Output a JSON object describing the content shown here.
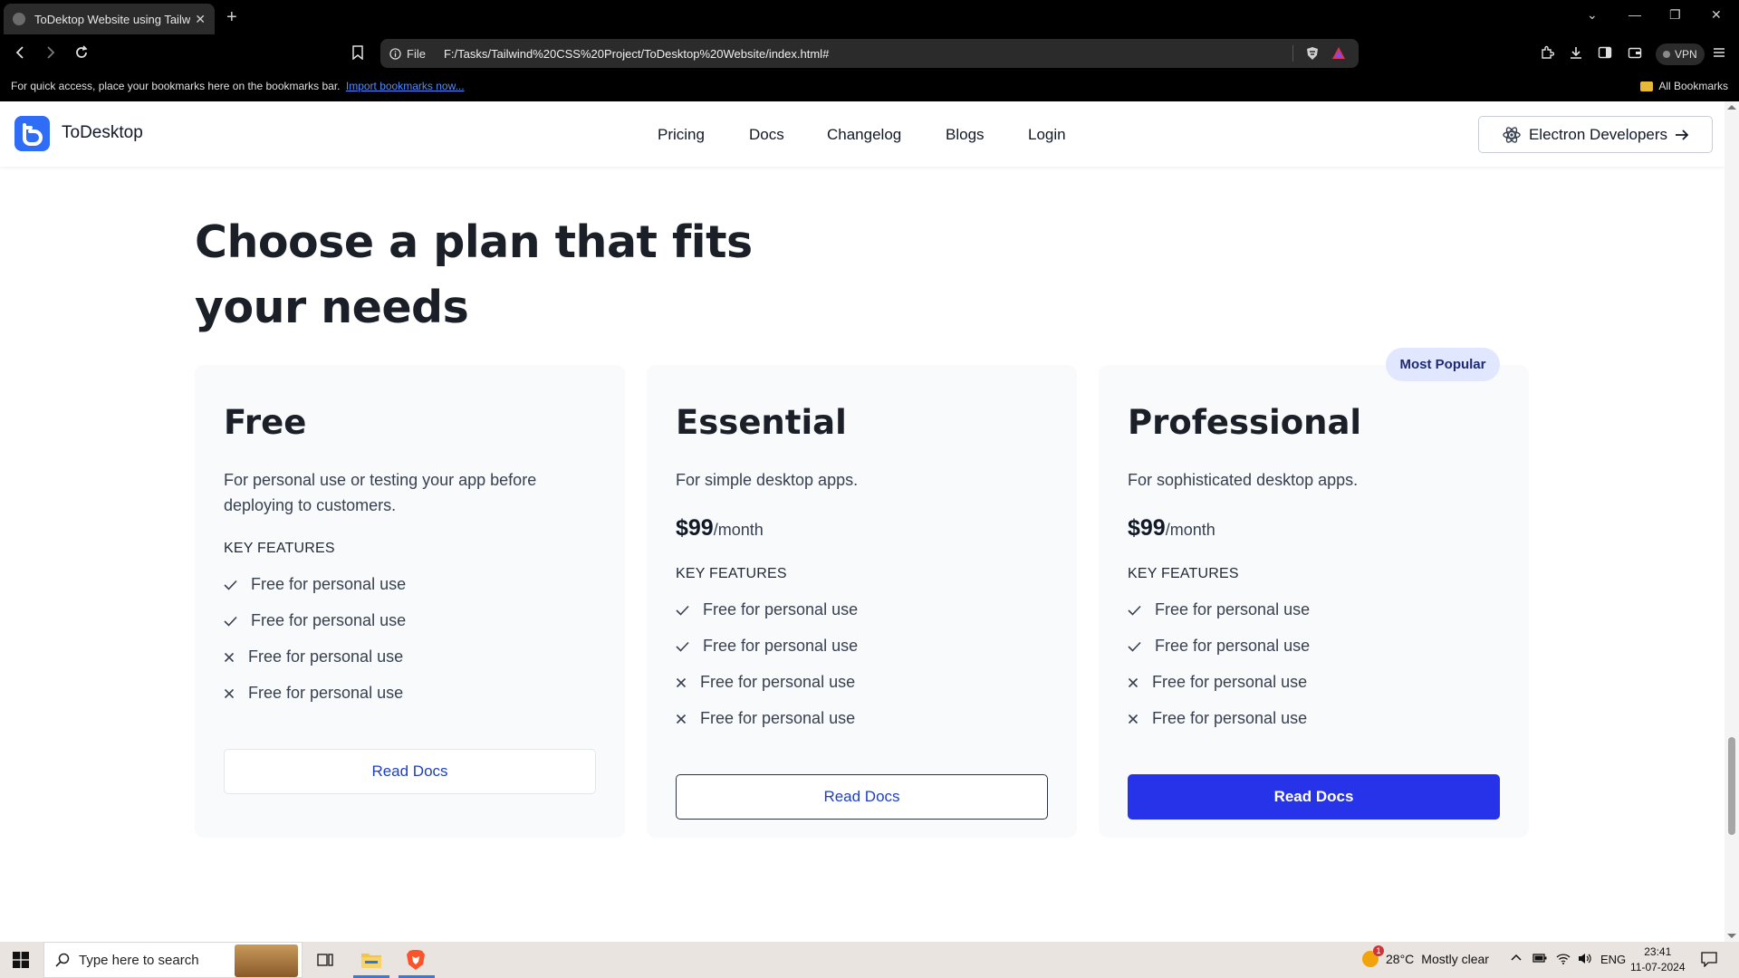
{
  "browser": {
    "tab_title": "ToDektop Website using Tailwi",
    "address_scheme": "File",
    "address_url": "F:/Tasks/Tailwind%20CSS%20Project/ToDesktop%20Website/index.html#",
    "vpn_label": "VPN",
    "bookmarks_message": "For quick access, place your bookmarks here on the bookmarks bar.",
    "bookmarks_link": "Import bookmarks now...",
    "all_bookmarks": "All Bookmarks"
  },
  "site": {
    "logo_text": "ToDesktop",
    "nav": [
      "Pricing",
      "Docs",
      "Changelog",
      "Blogs",
      "Login"
    ],
    "cta_label": "Electron Developers",
    "brand_color": "#2f6df6"
  },
  "pricing": {
    "headline_line1": "Choose a plan that fits",
    "headline_line2": "your needs",
    "popular_badge": "Most Popular",
    "plans": [
      {
        "name": "Free",
        "description": "For personal use or testing your app before deploying to customers.",
        "key_features_title": "KEY FEATURES",
        "features": [
          {
            "text": "Free for personal use",
            "included": true
          },
          {
            "text": "Free for personal use",
            "included": true
          },
          {
            "text": "Free for personal use",
            "included": false
          },
          {
            "text": "Free for personal use",
            "included": false
          }
        ],
        "button_label": "Read Docs"
      },
      {
        "name": "Essential",
        "description": "For simple desktop apps.",
        "price": "$99",
        "period": "/month",
        "key_features_title": "KEY FEATURES",
        "features": [
          {
            "text": "Free for personal use",
            "included": true
          },
          {
            "text": "Free for personal use",
            "included": true
          },
          {
            "text": "Free for personal use",
            "included": false
          },
          {
            "text": "Free for personal use",
            "included": false
          }
        ],
        "button_label": "Read Docs"
      },
      {
        "name": "Professional",
        "description": "For sophisticated desktop apps.",
        "price": "$99",
        "period": "/month",
        "key_features_title": "KEY FEATURES",
        "features": [
          {
            "text": "Free for personal use",
            "included": true
          },
          {
            "text": "Free for personal use",
            "included": true
          },
          {
            "text": "Free for personal use",
            "included": false
          },
          {
            "text": "Free for personal use",
            "included": false
          }
        ],
        "button_label": "Read Docs"
      }
    ]
  },
  "taskbar": {
    "search_placeholder": "Type here to search",
    "weather_temp": "28°C",
    "weather_text": "Mostly clear",
    "weather_badge": "1",
    "language": "ENG",
    "time": "23:41",
    "date": "11-07-2024"
  }
}
